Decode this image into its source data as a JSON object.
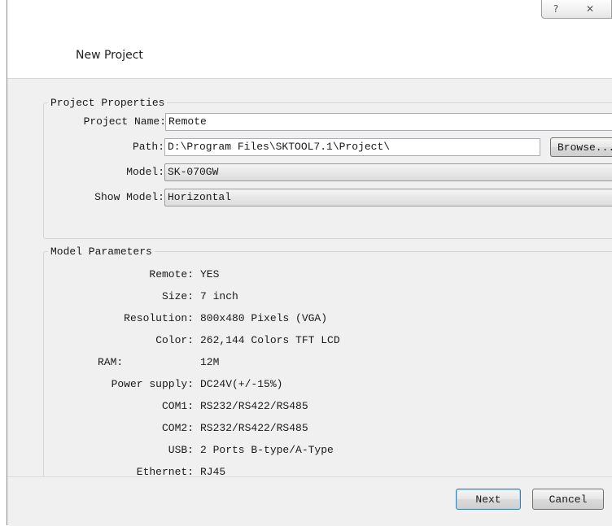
{
  "window": {
    "help_glyph": "?",
    "close_glyph": "✕"
  },
  "header": {
    "title": "New Project"
  },
  "project_properties": {
    "legend": "Project Properties",
    "name_label": "Project Name:",
    "name_value": "Remote",
    "path_label": "Path:",
    "path_value": "D:\\Program Files\\SKTOOL7.1\\Project\\",
    "browse_label": "Browse...",
    "model_label": "Model:",
    "model_value": "SK-070GW",
    "show_model_label": "Show Model:",
    "show_model_value": "Horizontal"
  },
  "model_parameters": {
    "legend": "Model Parameters",
    "remote_label": "Remote:",
    "remote_value": "YES",
    "size_label": "Size:",
    "size_value": "7 inch",
    "resolution_label": "Resolution:",
    "resolution_value": "800x480 Pixels (VGA)",
    "color_label": "Color:",
    "color_value": "262,144 Colors TFT LCD",
    "ram_label": "RAM:",
    "ram_value": "12M",
    "power_label": "Power supply:",
    "power_value": "DC24V(+/-15%)",
    "com1_label": "COM1:",
    "com1_value": "RS232/RS422/RS485",
    "com2_label": "COM2:",
    "com2_value": "RS232/RS422/RS485",
    "usb_label": "USB:",
    "usb_value": "2 Ports B-type/A-Type",
    "ethernet_label": "Ethernet:",
    "ethernet_value": "RJ45"
  },
  "footer": {
    "next_label": "Next",
    "cancel_label": "Cancel"
  },
  "colors": {
    "panel_bg": "#f0f0f0",
    "default_button_border": "#3c7fb1"
  }
}
